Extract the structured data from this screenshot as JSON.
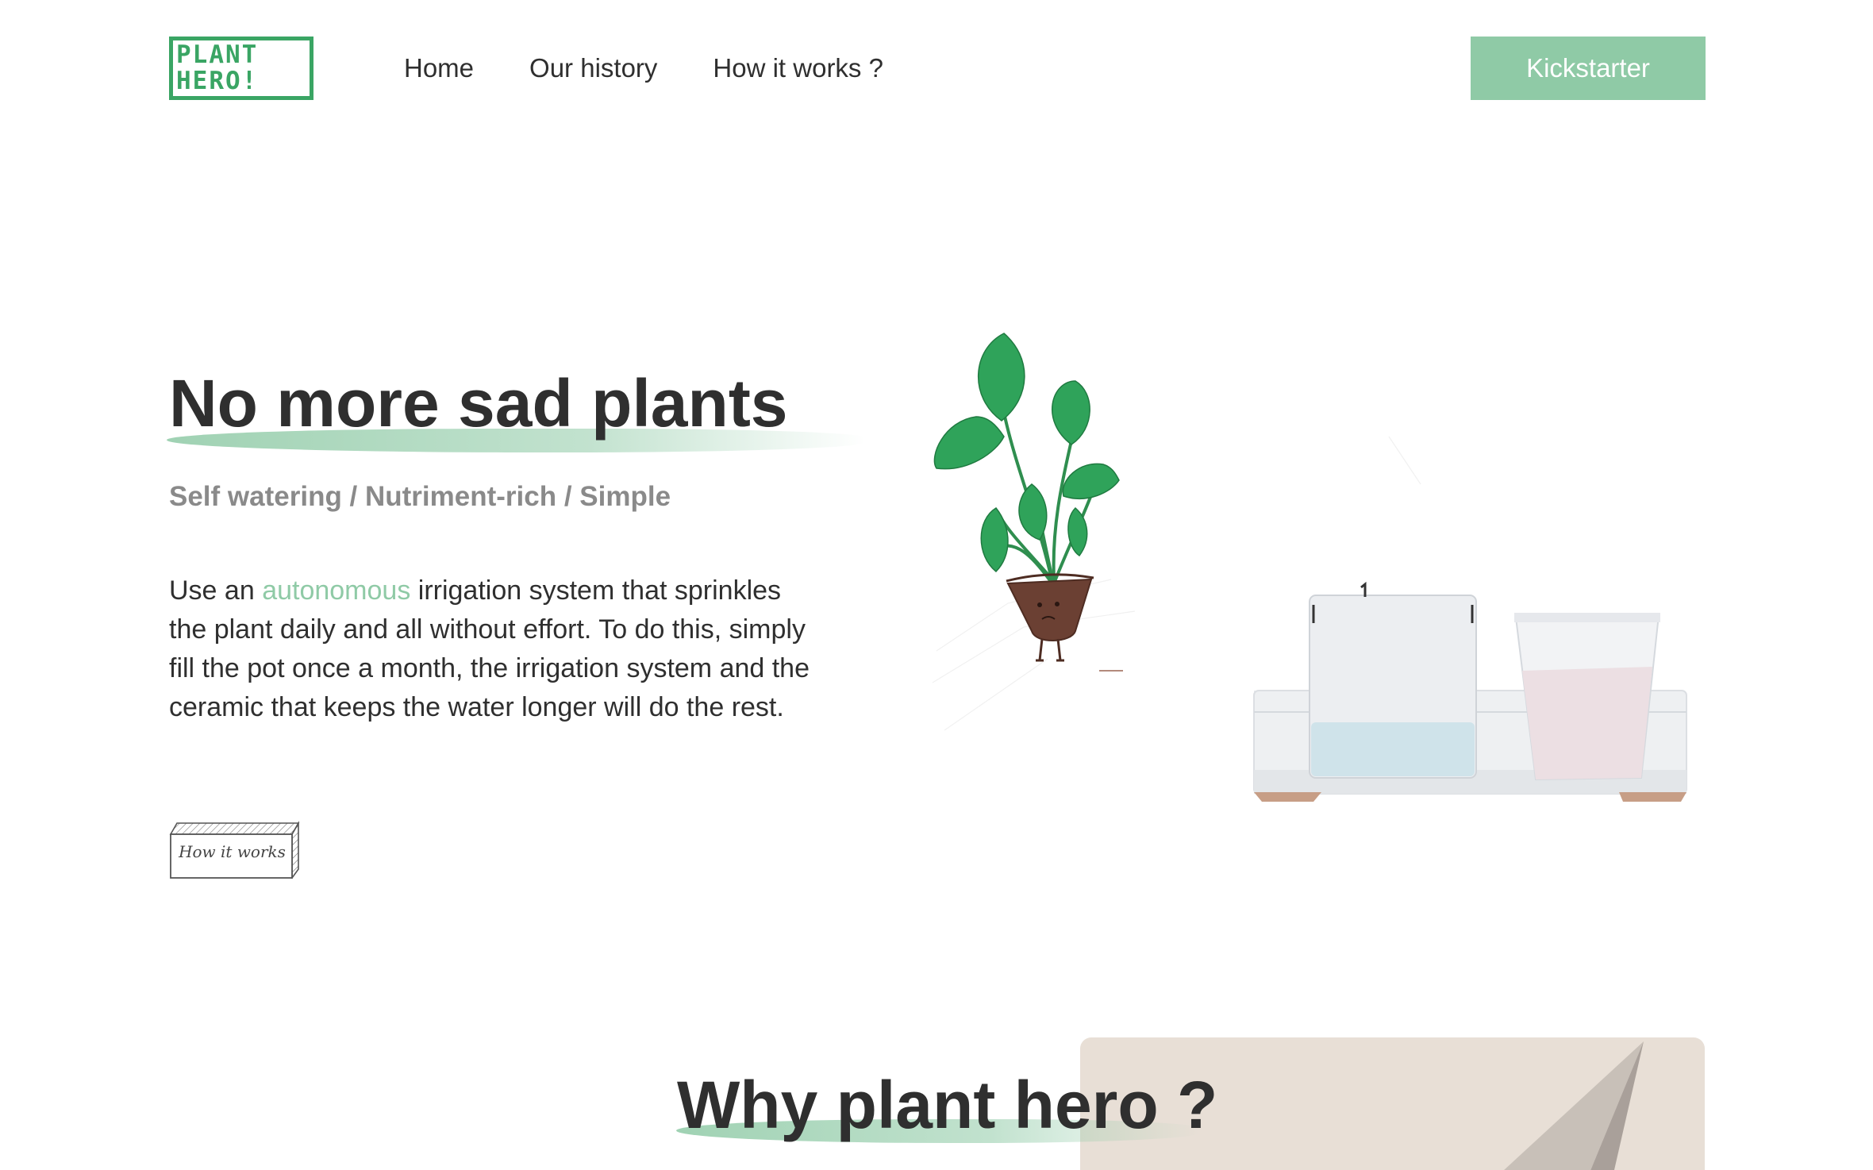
{
  "header": {
    "logo": {
      "line1": "PLANT",
      "line2": "HERO!"
    },
    "nav": [
      {
        "label": "Home"
      },
      {
        "label": "Our history"
      },
      {
        "label": "How it works ?"
      }
    ],
    "cta_label": "Kickstarter"
  },
  "hero": {
    "title": "No more sad plants",
    "subtitle": "Self watering / Nutriment-rich / Simple",
    "description": {
      "before": "Use an ",
      "accent": "autonomous",
      "after": " irrigation system that sprinkles the plant daily and all without effort. To do this, simply fill the pot once a month, the irrigation system and the ceramic that keeps the water longer will do the rest."
    },
    "button_label": "How it works"
  },
  "why": {
    "title": "Why plant hero ?"
  },
  "colors": {
    "accent": "#8fcaa6",
    "logo_green": "#3aa564",
    "text": "#2f2f2f",
    "muted": "#8a8a8a",
    "card_bg": "#e8dfd6"
  },
  "icons": [
    "plant-illustration",
    "planter-illustration",
    "sketch-button"
  ]
}
